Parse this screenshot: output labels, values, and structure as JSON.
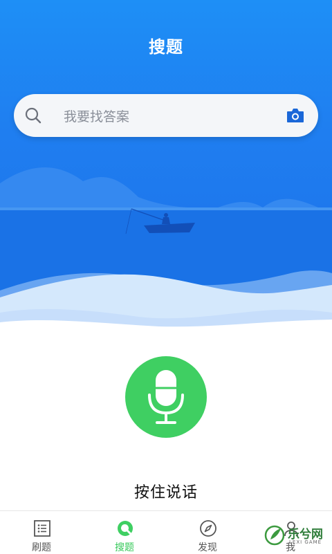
{
  "header": {
    "title": "搜题"
  },
  "search": {
    "placeholder": "我要找答案"
  },
  "icons": {
    "search": "search-icon",
    "camera": "camera-icon",
    "mic": "microphone-icon"
  },
  "voice": {
    "hold_label": "按住说话"
  },
  "tabs": [
    {
      "label": "刷题",
      "icon": "list-icon",
      "active": false
    },
    {
      "label": "搜题",
      "icon": "search-circle-icon",
      "active": true
    },
    {
      "label": "发现",
      "icon": "compass-icon",
      "active": false
    },
    {
      "label": "我",
      "icon": "person-icon",
      "active": false
    }
  ],
  "watermark": {
    "text": "乐兮网",
    "sub": "LEXI GAME"
  },
  "colors": {
    "brand_blue": "#1e8ff6",
    "accent_green": "#3fcf62",
    "camera_blue": "#1a67d8"
  }
}
